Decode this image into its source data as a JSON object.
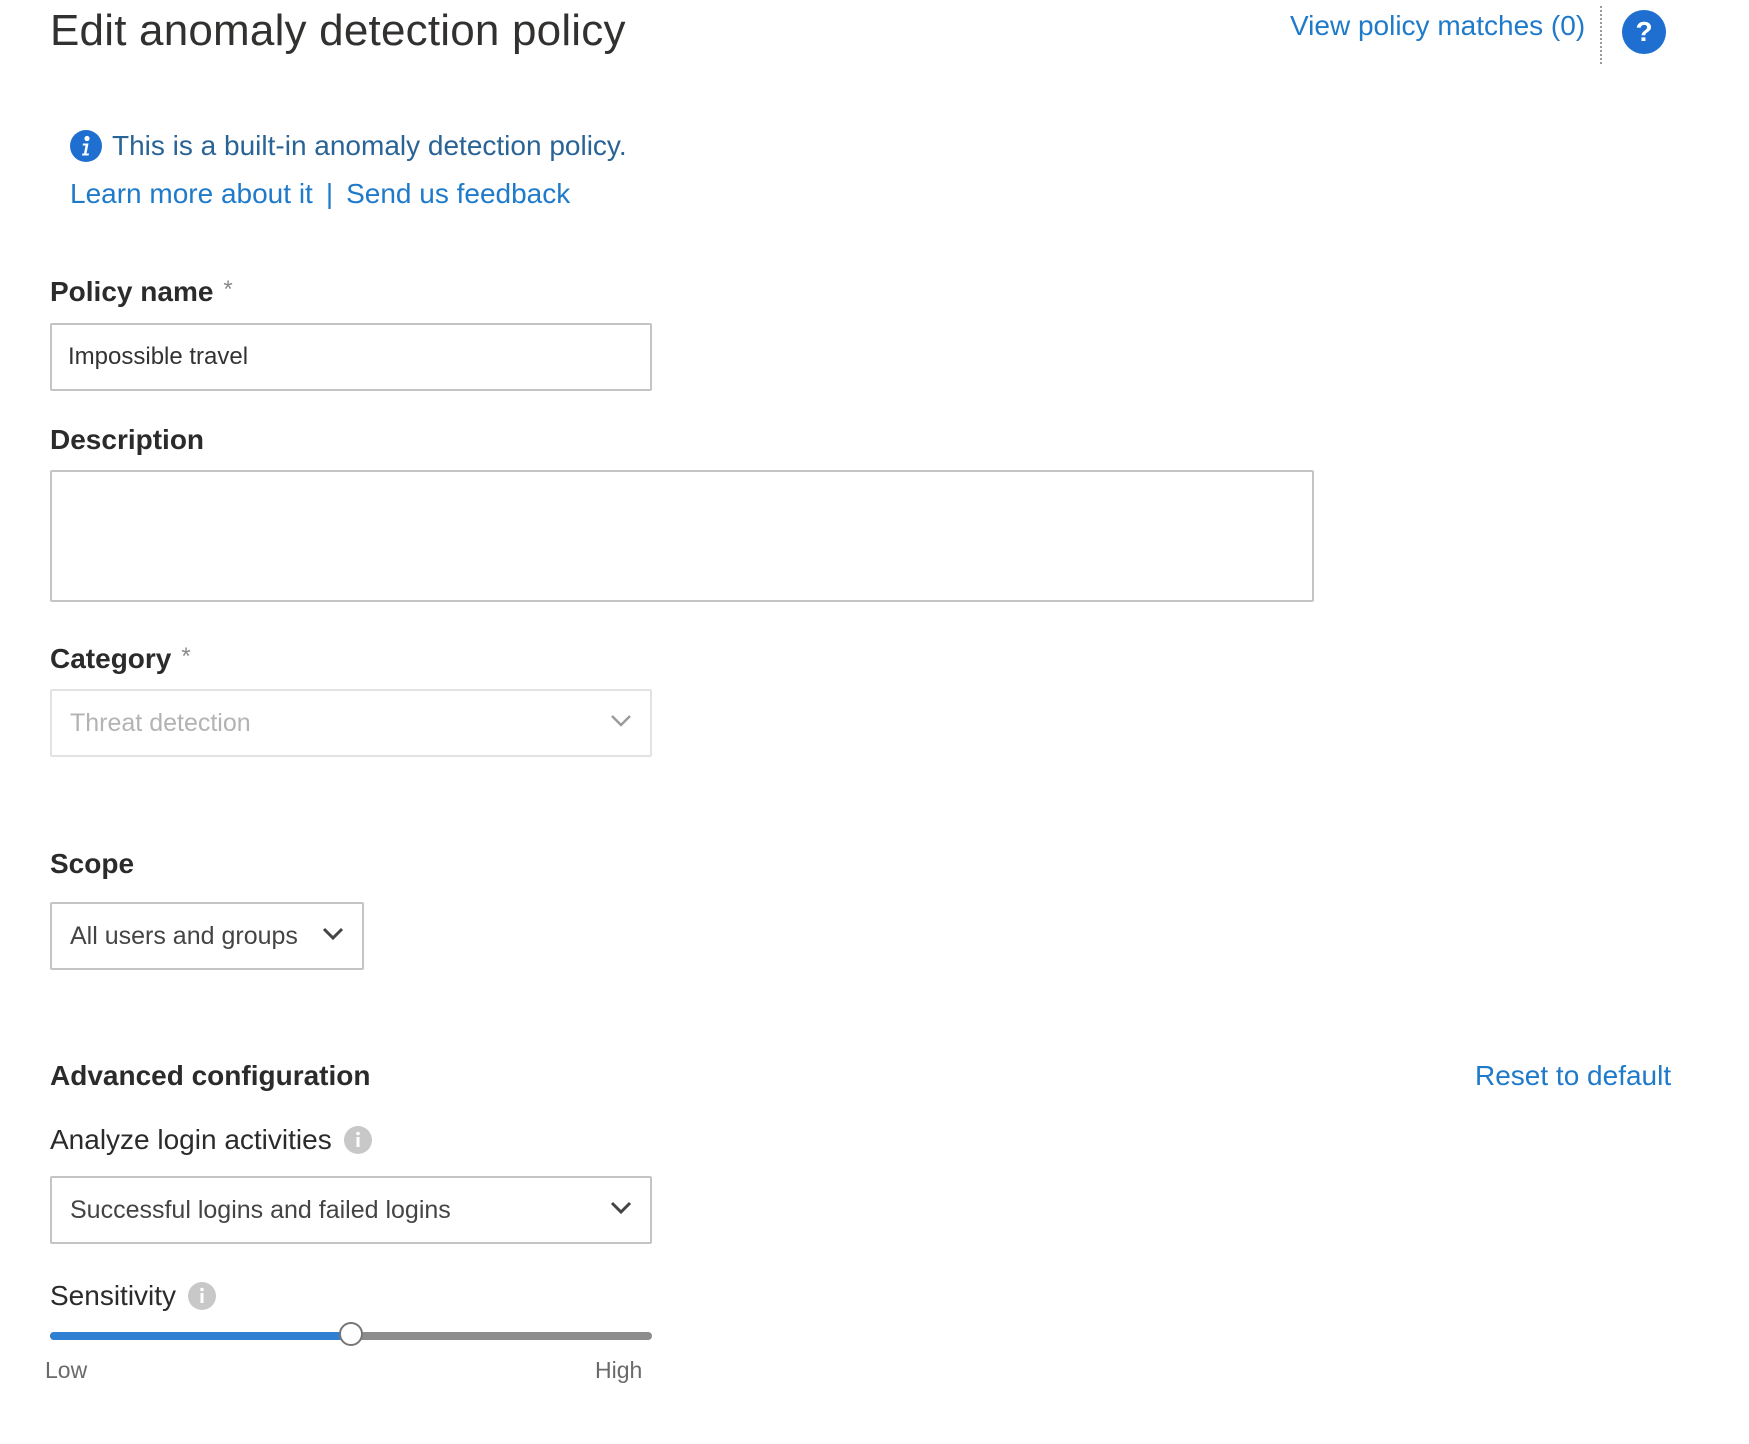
{
  "header": {
    "title": "Edit anomaly detection policy",
    "view_matches_label": "View policy matches (0)",
    "help_icon": "question-circle-icon"
  },
  "info_banner": {
    "icon": "info-circle-icon",
    "text": "This is a built-in anomaly detection policy.",
    "learn_more_label": "Learn more about it",
    "separator": "|",
    "feedback_label": "Send us feedback"
  },
  "form": {
    "policy_name": {
      "label": "Policy name",
      "required_mark": "*",
      "value": "Impossible travel"
    },
    "description": {
      "label": "Description",
      "value": ""
    },
    "category": {
      "label": "Category",
      "required_mark": "*",
      "selected": "Threat detection",
      "disabled": true
    },
    "scope": {
      "label": "Scope",
      "selected": "All users and groups"
    }
  },
  "advanced": {
    "title": "Advanced configuration",
    "reset_label": "Reset to default",
    "analyze_login": {
      "label": "Analyze login activities",
      "selected": "Successful logins and failed logins"
    },
    "sensitivity": {
      "label": "Sensitivity",
      "low_label": "Low",
      "high_label": "High",
      "level": 0.5
    }
  },
  "colors": {
    "link": "#1f7ac9",
    "accent": "#2f7fd3",
    "help_icon_bg": "#1f6fd1"
  }
}
